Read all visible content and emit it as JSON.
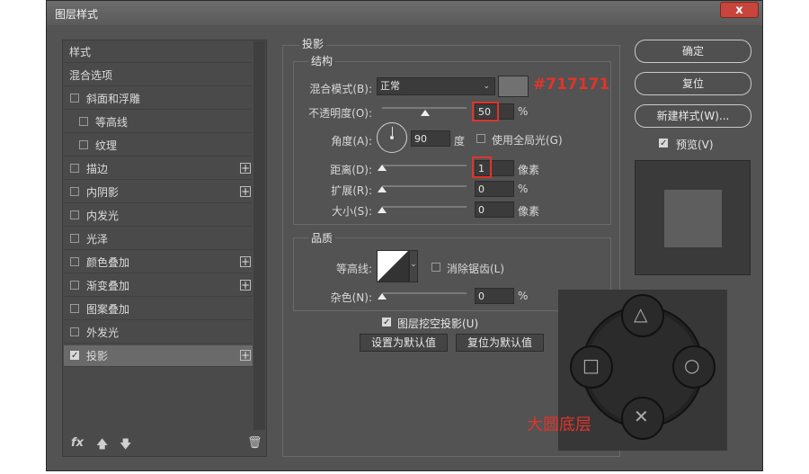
{
  "window": {
    "title": "图层样式",
    "close": "x"
  },
  "sidebar": {
    "items": [
      {
        "label": "样式",
        "checkbox": false,
        "plus": false,
        "checked": false
      },
      {
        "label": "混合选项",
        "checkbox": false,
        "plus": false,
        "checked": false
      },
      {
        "label": "斜面和浮雕",
        "checkbox": true,
        "plus": false,
        "checked": false
      },
      {
        "label": "等高线",
        "checkbox": true,
        "plus": false,
        "checked": false,
        "indent": true
      },
      {
        "label": "纹理",
        "checkbox": true,
        "plus": false,
        "checked": false,
        "indent": true
      },
      {
        "label": "描边",
        "checkbox": true,
        "plus": true,
        "checked": false
      },
      {
        "label": "内阴影",
        "checkbox": true,
        "plus": true,
        "checked": false
      },
      {
        "label": "内发光",
        "checkbox": true,
        "plus": false,
        "checked": false
      },
      {
        "label": "光泽",
        "checkbox": true,
        "plus": false,
        "checked": false
      },
      {
        "label": "颜色叠加",
        "checkbox": true,
        "plus": true,
        "checked": false
      },
      {
        "label": "渐变叠加",
        "checkbox": true,
        "plus": true,
        "checked": false
      },
      {
        "label": "图案叠加",
        "checkbox": true,
        "plus": false,
        "checked": false
      },
      {
        "label": "外发光",
        "checkbox": true,
        "plus": false,
        "checked": false
      },
      {
        "label": "投影",
        "checkbox": true,
        "plus": true,
        "checked": true,
        "selected": true
      }
    ],
    "fx": "fx",
    "plus_glyph": "+",
    "check_glyph": "✓"
  },
  "shadow": {
    "section_title": "投影",
    "structure": {
      "title": "结构",
      "blend_mode_label": "混合模式(B):",
      "blend_mode_value": "正常",
      "color_swatch": "#717171",
      "opacity_label": "不透明度(O):",
      "opacity_value": "50",
      "opacity_unit": "%",
      "angle_label": "角度(A):",
      "angle_value": "90",
      "angle_unit": "度",
      "global_light_label": "使用全局光(G)",
      "distance_label": "距离(D):",
      "distance_value": "1",
      "distance_unit": "像素",
      "spread_label": "扩展(R):",
      "spread_value": "0",
      "spread_unit": "%",
      "size_label": "大小(S):",
      "size_value": "0",
      "size_unit": "像素"
    },
    "quality": {
      "title": "品质",
      "contour_label": "等高线:",
      "antialias_label": "消除锯齿(L)",
      "noise_label": "杂色(N):",
      "noise_value": "0",
      "noise_unit": "%"
    },
    "knockout_label": "图层挖空投影(U)",
    "set_default": "设置为默认值",
    "reset_default": "复位为默认值"
  },
  "actions": {
    "ok": "确定",
    "reset": "复位",
    "new_style": "新建样式(W)...",
    "preview_label": "预览(V)"
  },
  "annotations": {
    "hex_color": "#717171",
    "caption": "大圆底层",
    "accent": "#e0342b"
  },
  "gamepad": {
    "up": "△",
    "left": "□",
    "right": "○",
    "down": "✕"
  }
}
